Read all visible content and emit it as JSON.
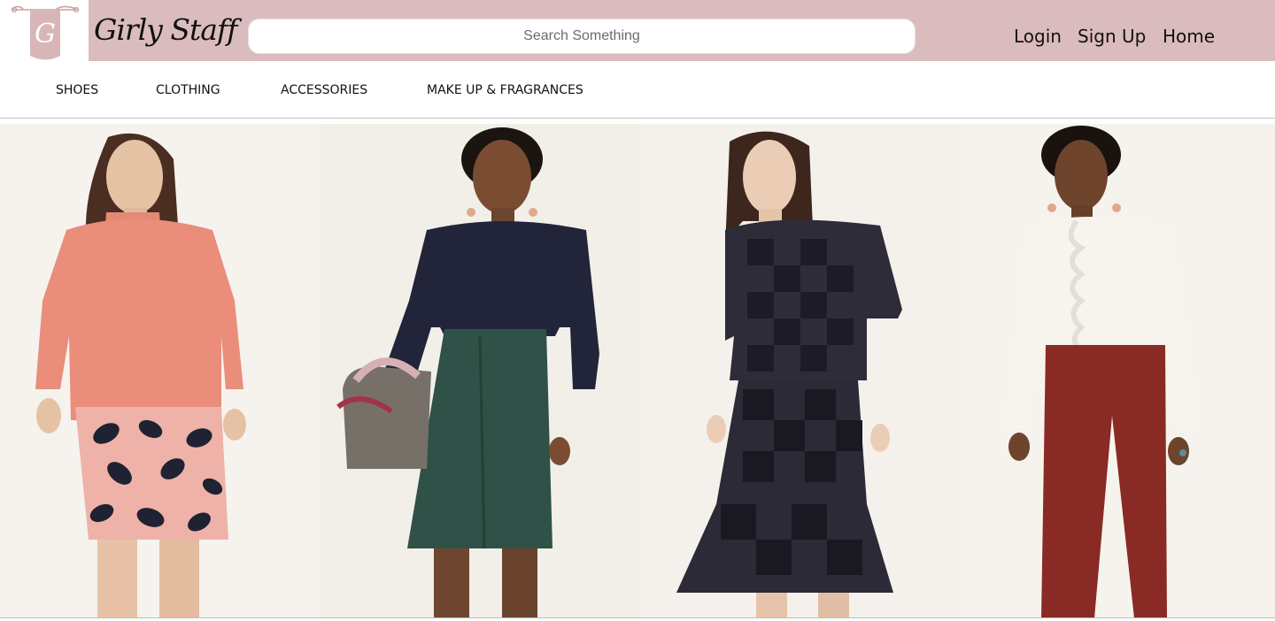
{
  "brand": {
    "logo_letter": "G",
    "name": "Girly Staff"
  },
  "search": {
    "placeholder": "Search Something",
    "value": ""
  },
  "header_nav": [
    {
      "label": "Login"
    },
    {
      "label": "Sign Up"
    },
    {
      "label": "Home"
    }
  ],
  "categories": [
    {
      "label": "SHOES"
    },
    {
      "label": "CLOTHING"
    },
    {
      "label": "ACCESSORIES"
    },
    {
      "label": "MAKE UP & FRAGRANCES"
    }
  ],
  "colors": {
    "header_bg": "#dbbcbe",
    "logo_badge": "#d8b6b8",
    "hero_bg": "#f5f2ed"
  }
}
